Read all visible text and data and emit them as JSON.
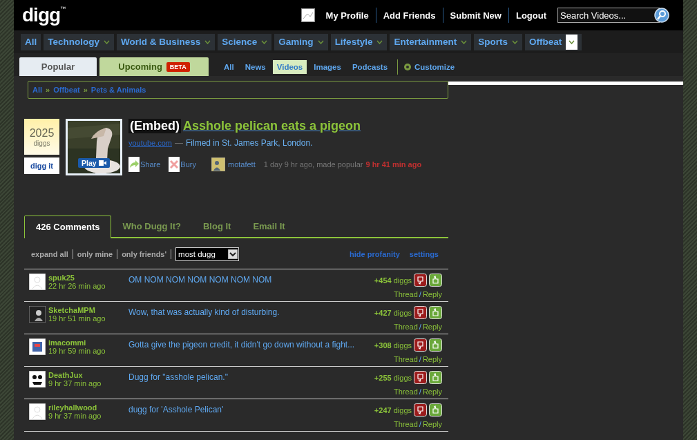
{
  "header": {
    "logo": "digg",
    "trademark": "™",
    "user_links": [
      "My Profile",
      "Add Friends",
      "Submit New",
      "Logout"
    ],
    "search": {
      "placeholder": "Search Videos..."
    }
  },
  "topics": [
    {
      "label": "All",
      "menu": false,
      "selected": false
    },
    {
      "label": "Technology",
      "menu": true,
      "selected": false
    },
    {
      "label": "World & Business",
      "menu": true,
      "selected": false
    },
    {
      "label": "Science",
      "menu": true,
      "selected": false
    },
    {
      "label": "Gaming",
      "menu": true,
      "selected": false
    },
    {
      "label": "Lifestyle",
      "menu": true,
      "selected": false
    },
    {
      "label": "Entertainment",
      "menu": true,
      "selected": false
    },
    {
      "label": "Sports",
      "menu": true,
      "selected": false
    },
    {
      "label": "Offbeat",
      "menu": true,
      "selected": true
    }
  ],
  "sort_tabs": [
    {
      "label": "Popular",
      "kind": "popular"
    },
    {
      "label": "Upcoming",
      "kind": "upcoming",
      "badge": "BETA"
    }
  ],
  "media_filters": [
    {
      "label": "All",
      "selected": false
    },
    {
      "label": "News",
      "selected": false
    },
    {
      "label": "Videos",
      "selected": true
    },
    {
      "label": "Images",
      "selected": false
    },
    {
      "label": "Podcasts",
      "selected": false
    }
  ],
  "customize": "Customize",
  "breadcrumb": {
    "separator": "»",
    "items": [
      "All",
      "Offbeat",
      "Pets & Animals"
    ]
  },
  "story": {
    "diggs": "2025",
    "diggs_label": "diggs",
    "digg_button": "digg it",
    "play": "Play",
    "tag": "(Embed)",
    "title": "Asshole pelican eats a pigeon",
    "source": "youtube.com",
    "dash": "—",
    "description": "Filmed in St. James Park, London.",
    "share": "Share",
    "bury": "Bury",
    "user": "motafett",
    "time": "1 day 9 hr ago, made popular",
    "popular_time": "9 hr 41 min ago"
  },
  "comment_tabs": [
    {
      "label": "426 Comments",
      "selected": true
    },
    {
      "label": "Who Dugg It?",
      "selected": false
    },
    {
      "label": "Blog It",
      "selected": false
    },
    {
      "label": "Email It",
      "selected": false
    }
  ],
  "comment_filters": [
    "expand all",
    "only mine",
    "only friends'"
  ],
  "sort_select": {
    "value": "most dugg"
  },
  "comment_links": [
    "hide profanity",
    "settings"
  ],
  "comments": [
    {
      "user": "spuk25",
      "time": "22 hr 26 min ago",
      "text": "OM NOM NOM NOM NOM NOM NOM",
      "diggs": "+454",
      "diggs_label": "diggs",
      "kind": "blank",
      "thread": "Thread",
      "separator": "/",
      "reply": "Reply"
    },
    {
      "user": "SketchaMPM",
      "time": "19 hr 51 min ago",
      "text": "Wow, that was actually kind of disturbing.",
      "diggs": "+427",
      "diggs_label": "diggs",
      "kind": "dark",
      "thread": "Thread",
      "separator": "/",
      "reply": "Reply"
    },
    {
      "user": "imacommi",
      "time": "19 hr 59 min ago",
      "text": "Gotta give the pigeon credit, it didn't go down without a fight...",
      "diggs": "+308",
      "diggs_label": "diggs",
      "kind": "sign",
      "thread": "Thread",
      "separator": "/",
      "reply": "Reply"
    },
    {
      "user": "DeathJux",
      "time": "9 hr 37 min ago",
      "text": "Dugg for \"asshole pelican.\"",
      "diggs": "+255",
      "diggs_label": "diggs",
      "kind": "face",
      "thread": "Thread",
      "separator": "/",
      "reply": "Reply"
    },
    {
      "user": "rileyhallwood",
      "time": "9 hr 37 min ago",
      "text": "dugg for 'Asshole Pelican'",
      "diggs": "+247",
      "diggs_label": "diggs",
      "kind": "blank",
      "thread": "Thread",
      "separator": "/",
      "reply": "Reply"
    }
  ]
}
